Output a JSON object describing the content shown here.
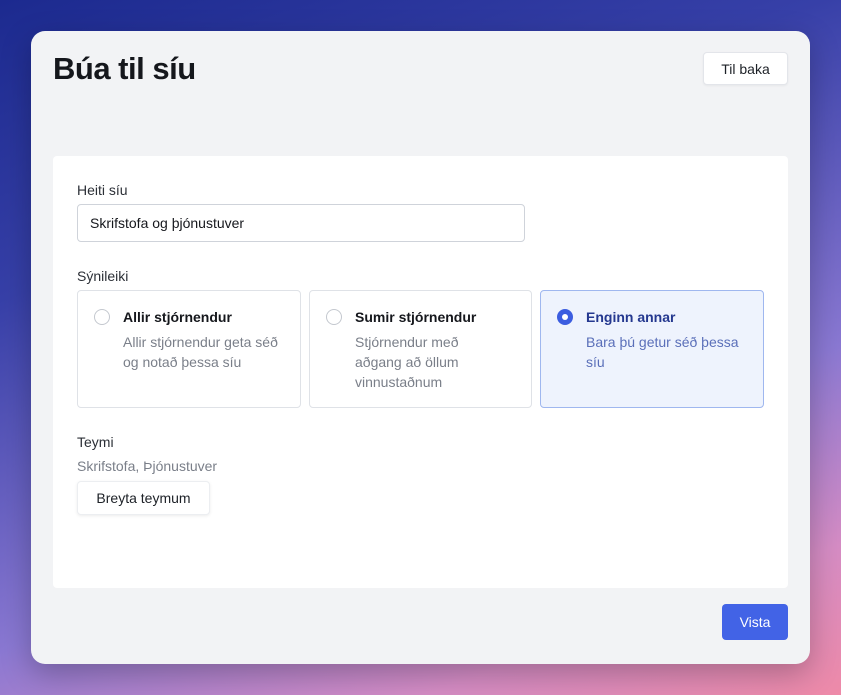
{
  "dialog": {
    "title": "Búa til síu",
    "back_label": "Til baka",
    "save_label": "Vista"
  },
  "form": {
    "name_label": "Heiti síu",
    "name_value": "Skrifstofa og þjónustuver",
    "visibility_label": "Sýnileiki",
    "visibility_options": [
      {
        "title": "Allir stjórnendur",
        "description": "Allir stjórnendur geta séð og notað þessa síu",
        "selected": false
      },
      {
        "title": "Sumir stjórnendur",
        "description": "Stjórnendur með aðgang að öllum vinnustaðnum",
        "selected": false
      },
      {
        "title": "Enginn annar",
        "description": "Bara þú getur séð þessa síu",
        "selected": true
      }
    ],
    "teams_label": "Teymi",
    "teams_value": "Skrifstofa, Þjónustuver",
    "edit_teams_label": "Breyta teymum"
  },
  "colors": {
    "accent": "#4263e6",
    "selected_bg": "#eef3fd"
  }
}
